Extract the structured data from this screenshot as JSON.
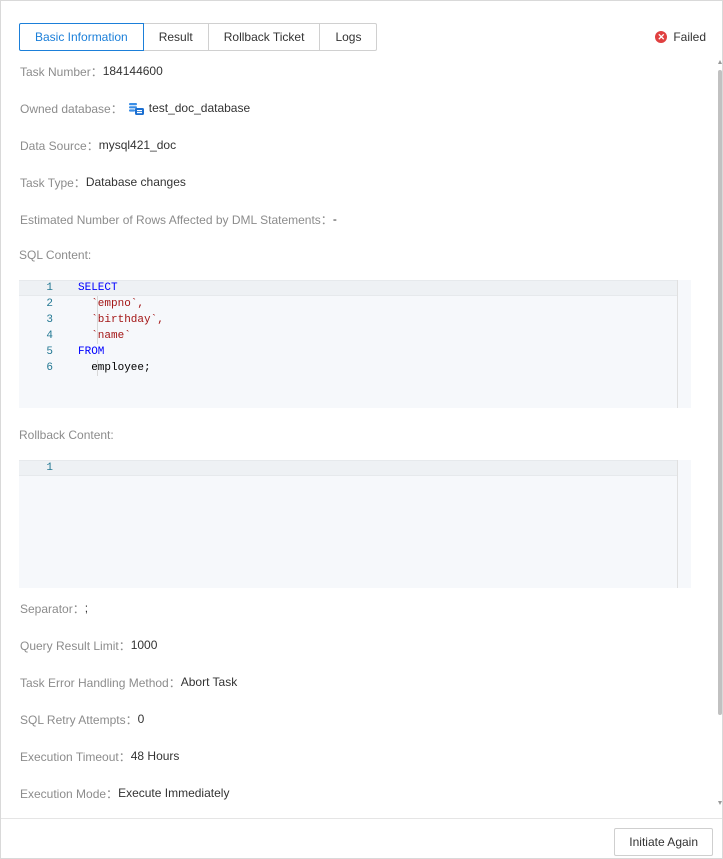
{
  "tabs": [
    {
      "label": "Basic Information",
      "active": true
    },
    {
      "label": "Result"
    },
    {
      "label": "Rollback Ticket"
    },
    {
      "label": "Logs"
    }
  ],
  "status": {
    "text": "Failed",
    "icon": "error-circle-icon",
    "color": "#e04040"
  },
  "fields": {
    "task_number": {
      "label": "Task Number：",
      "value": "184144600"
    },
    "owned_database": {
      "label": "Owned database：",
      "value": "test_doc_database",
      "icon": "database-icon"
    },
    "data_source": {
      "label": "Data Source：",
      "value": "mysql421_doc"
    },
    "task_type": {
      "label": "Task Type：",
      "value": "Database changes"
    },
    "estimated_rows": {
      "label": "Estimated Number of Rows Affected by DML Statements：",
      "value": "-"
    },
    "sql_content": {
      "label": "SQL Content:"
    },
    "rollback_content": {
      "label": "Rollback Content:"
    },
    "separator": {
      "label": "Separator：",
      "value": ";"
    },
    "query_limit": {
      "label": "Query Result Limit：",
      "value": "1000"
    },
    "error_handling": {
      "label": "Task Error Handling Method：",
      "value": "Abort Task"
    },
    "retry_attempts": {
      "label": "SQL Retry Attempts：",
      "value": "0"
    },
    "execution_timeout": {
      "label": "Execution Timeout：",
      "value": "48 Hours"
    },
    "execution_mode": {
      "label": "Execution Mode：",
      "value": "Execute Immediately"
    }
  },
  "sql_editor": {
    "lines": [
      {
        "no": "1",
        "text": "SELECT"
      },
      {
        "no": "2",
        "text": "  `empno`,"
      },
      {
        "no": "3",
        "text": "  `birthday`,"
      },
      {
        "no": "4",
        "text": "  `name`"
      },
      {
        "no": "5",
        "text": "FROM"
      },
      {
        "no": "6",
        "text": "  employee;"
      }
    ]
  },
  "rollback_editor": {
    "lines": [
      {
        "no": "1",
        "text": ""
      }
    ]
  },
  "footer": {
    "button_label": "Initiate Again"
  },
  "colors": {
    "accent": "#1b7fd9",
    "error": "#e04040",
    "label": "#8c8c8c"
  }
}
